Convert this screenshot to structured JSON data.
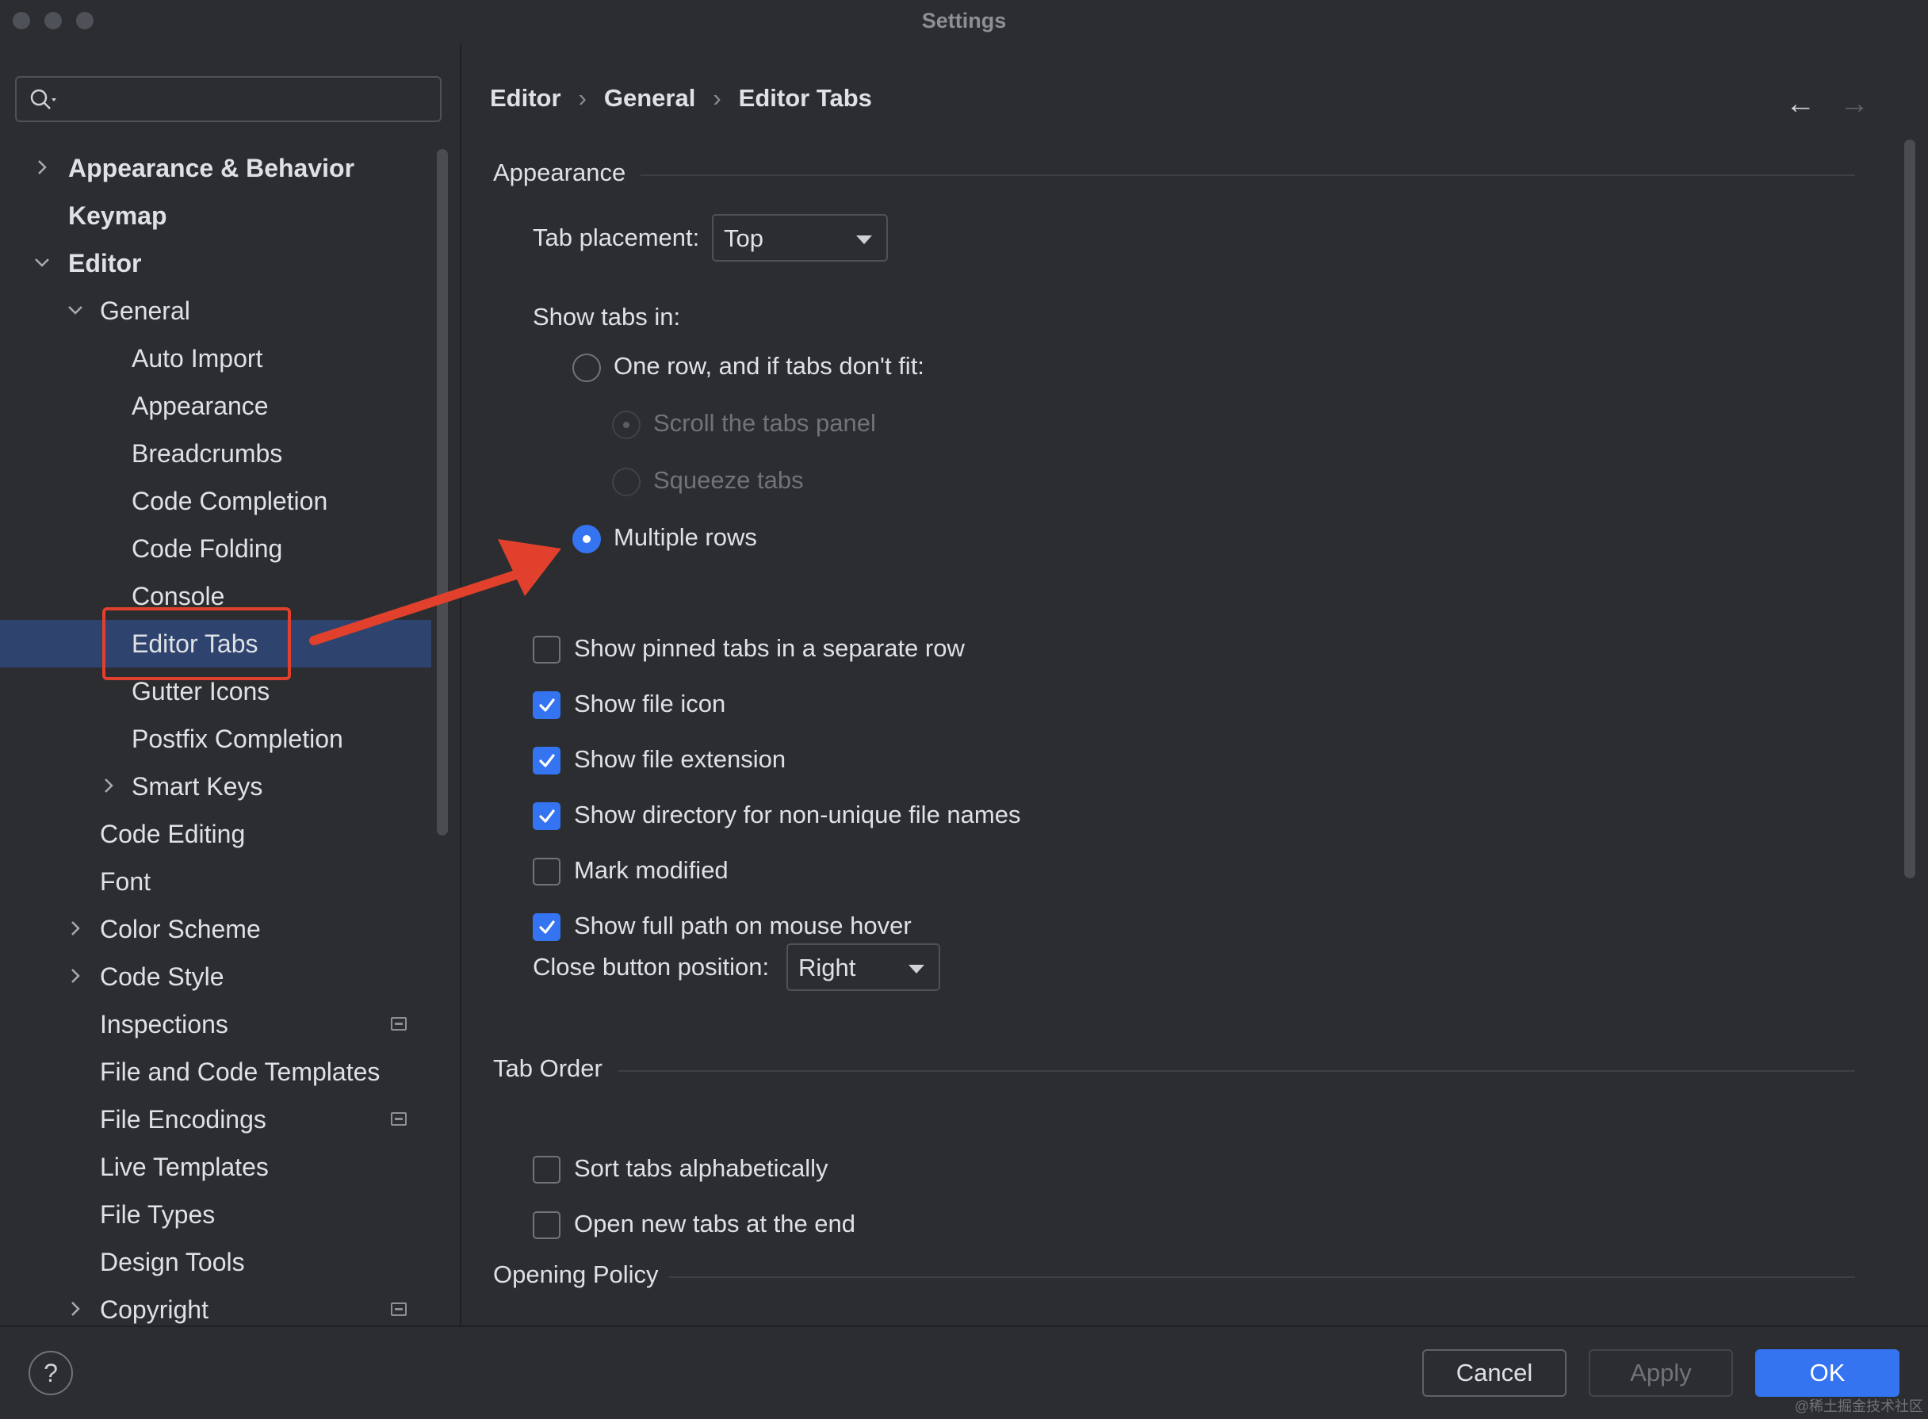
{
  "window": {
    "title": "Settings"
  },
  "search": {
    "placeholder": "",
    "icon": "search-icon"
  },
  "sidebar": {
    "items": [
      {
        "label": "Appearance & Behavior",
        "level": 0,
        "bold": true,
        "expander": "collapsed"
      },
      {
        "label": "Keymap",
        "level": 0,
        "bold": true,
        "expander": "none"
      },
      {
        "label": "Editor",
        "level": 0,
        "bold": true,
        "expander": "expanded"
      },
      {
        "label": "General",
        "level": 1,
        "bold": false,
        "expander": "expanded"
      },
      {
        "label": "Auto Import",
        "level": 2,
        "bold": false,
        "expander": "none"
      },
      {
        "label": "Appearance",
        "level": 2,
        "bold": false,
        "expander": "none"
      },
      {
        "label": "Breadcrumbs",
        "level": 2,
        "bold": false,
        "expander": "none"
      },
      {
        "label": "Code Completion",
        "level": 2,
        "bold": false,
        "expander": "none"
      },
      {
        "label": "Code Folding",
        "level": 2,
        "bold": false,
        "expander": "none"
      },
      {
        "label": "Console",
        "level": 2,
        "bold": false,
        "expander": "none"
      },
      {
        "label": "Editor Tabs",
        "level": 2,
        "bold": false,
        "expander": "none",
        "selected": true
      },
      {
        "label": "Gutter Icons",
        "level": 2,
        "bold": false,
        "expander": "none"
      },
      {
        "label": "Postfix Completion",
        "level": 2,
        "bold": false,
        "expander": "none"
      },
      {
        "label": "Smart Keys",
        "level": 2,
        "bold": false,
        "expander": "collapsed"
      },
      {
        "label": "Code Editing",
        "level": 1,
        "bold": false,
        "expander": "none"
      },
      {
        "label": "Font",
        "level": 1,
        "bold": false,
        "expander": "none"
      },
      {
        "label": "Color Scheme",
        "level": 1,
        "bold": false,
        "expander": "collapsed"
      },
      {
        "label": "Code Style",
        "level": 1,
        "bold": false,
        "expander": "collapsed"
      },
      {
        "label": "Inspections",
        "level": 1,
        "bold": false,
        "expander": "none",
        "badge": "project-settings-icon"
      },
      {
        "label": "File and Code Templates",
        "level": 1,
        "bold": false,
        "expander": "none"
      },
      {
        "label": "File Encodings",
        "level": 1,
        "bold": false,
        "expander": "none",
        "badge": "project-settings-icon"
      },
      {
        "label": "Live Templates",
        "level": 1,
        "bold": false,
        "expander": "none"
      },
      {
        "label": "File Types",
        "level": 1,
        "bold": false,
        "expander": "none"
      },
      {
        "label": "Design Tools",
        "level": 1,
        "bold": false,
        "expander": "none"
      },
      {
        "label": "Copyright",
        "level": 1,
        "bold": false,
        "expander": "collapsed",
        "badge": "project-settings-icon"
      }
    ]
  },
  "breadcrumb": {
    "part1": "Editor",
    "part2": "General",
    "part3": "Editor Tabs",
    "separator": "›"
  },
  "nav": {
    "back": "←",
    "forward": "→"
  },
  "appearance": {
    "section_title": "Appearance",
    "tab_placement_label": "Tab placement:",
    "tab_placement_value": "Top",
    "show_tabs_in_label": "Show tabs in:",
    "radio_one_row": "One row, and if tabs don't fit:",
    "radio_scroll": "Scroll the tabs panel",
    "radio_squeeze": "Squeeze tabs",
    "radio_multiple": "Multiple rows",
    "checkboxes": [
      {
        "label": "Show pinned tabs in a separate row",
        "checked": false
      },
      {
        "label": "Show file icon",
        "checked": true
      },
      {
        "label": "Show file extension",
        "checked": true
      },
      {
        "label": "Show directory for non-unique file names",
        "checked": true
      },
      {
        "label": "Mark modified",
        "checked": false
      },
      {
        "label": "Show full path on mouse hover",
        "checked": true
      }
    ],
    "close_button_label": "Close button position:",
    "close_button_value": "Right"
  },
  "tab_order": {
    "section_title": "Tab Order",
    "checkboxes": [
      {
        "label": "Sort tabs alphabetically",
        "checked": false
      },
      {
        "label": "Open new tabs at the end",
        "checked": false
      }
    ]
  },
  "opening_policy": {
    "section_title": "Opening Policy"
  },
  "footer": {
    "help": "?",
    "cancel": "Cancel",
    "apply": "Apply",
    "ok": "OK",
    "watermark": "@稀土掘金技术社区"
  },
  "colors": {
    "accent": "#3574f0",
    "selection": "#2e436e",
    "annotation_red": "#e1412c",
    "background": "#2b2d30"
  }
}
